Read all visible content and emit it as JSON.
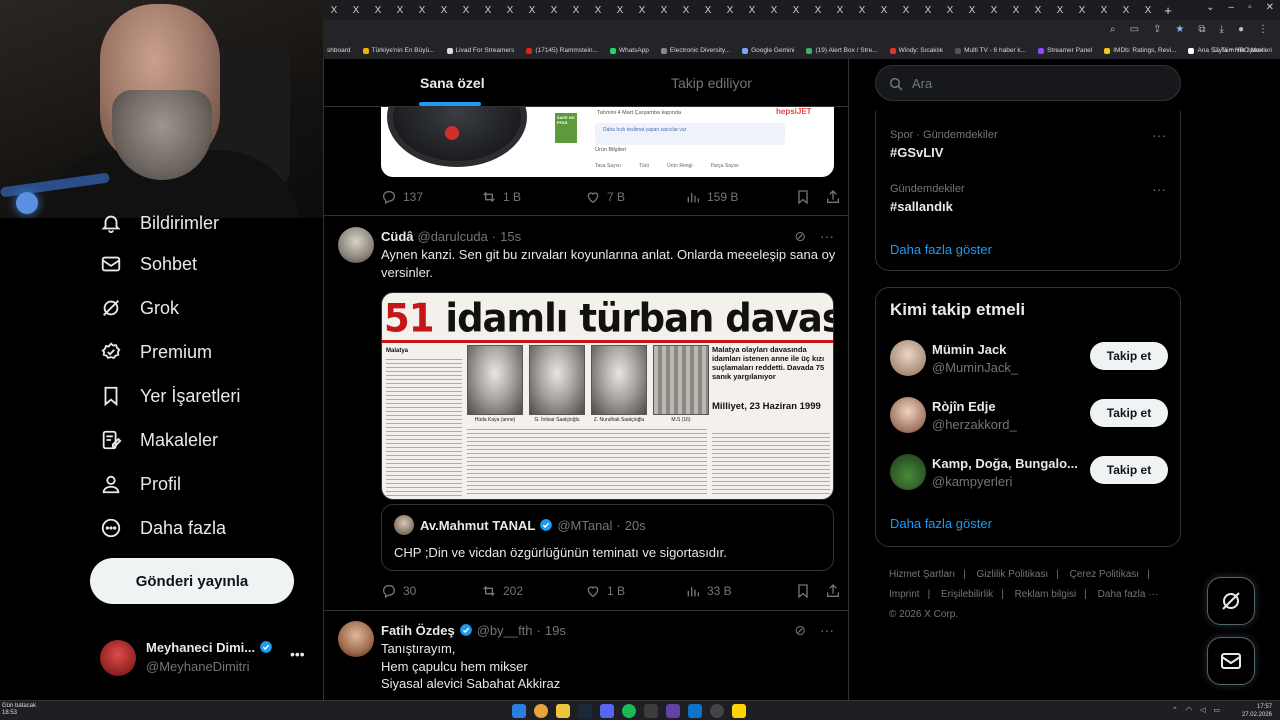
{
  "browser": {
    "tab_close_glyph": "X",
    "bookmarks": [
      "shboard",
      "Türkiye'nin En Büyü...",
      "Livad For Streamers",
      "(17145) Rammstein...",
      "WhatsApp",
      "Electronic Diversity...",
      "Google Gemini",
      "(19) Alert Box / Stre...",
      "Windy: Sıcaklık",
      "Multi TV - 6 haber k...",
      "Streamer Panel",
      "IMDb: Ratings, Revi...",
      "Ana Sayfa + HBO Max"
    ],
    "bookmarks_all": "Tüm Yer İşaretleri"
  },
  "nav": {
    "items": [
      {
        "label": "Bildirimler",
        "icon": "bell-icon"
      },
      {
        "label": "Sohbet",
        "icon": "mail-icon"
      },
      {
        "label": "Grok",
        "icon": "grok-icon"
      },
      {
        "label": "Premium",
        "icon": "premium-icon"
      },
      {
        "label": "Yer İşaretleri",
        "icon": "bookmark-icon"
      },
      {
        "label": "Makaleler",
        "icon": "article-icon"
      },
      {
        "label": "Profil",
        "icon": "person-icon"
      },
      {
        "label": "Daha fazla",
        "icon": "more-circle-icon"
      }
    ],
    "post_button": "Gönderi yayınla",
    "account": {
      "name": "Meyhaneci Dimi...",
      "handle": "@MeyhaneDimitri",
      "more": "•••"
    }
  },
  "feed": {
    "tabs": {
      "for_you": "Sana özel",
      "following": "Takip ediliyor"
    },
    "product_snippet": {
      "line1": "Tahmini 4 Mart Çarşamba kapında",
      "line2": "Daha hızlı teslimat yapan satıcılar var",
      "section": "Ürün Bilgileri",
      "cols": [
        "Tava Sayısı",
        "Türü",
        "Ürün Rengi",
        "Parça Sayısı"
      ],
      "brand": "hepsiJET",
      "badge": "SAFE NO PFAS"
    },
    "tweet0_actions": {
      "replies": "137",
      "reposts": "1 B",
      "likes": "7 B",
      "views": "159 B"
    },
    "tweet1": {
      "name": "Cüdâ",
      "handle": "@darulcuda",
      "time": "15s",
      "text": "Aynen kanzi. Sen git bu zırvaları koyunlarına anlat. Onlarda meeeleşip sana oy versinler.",
      "image": {
        "headline_num": "51",
        "headline_rest": "idamlı türban davası",
        "region": "Malatya",
        "lead": "Malatya olayları davasında idamları istenen anne ile üç kızı suçlamaları reddetti. Davada 75 sanık yargılanıyor",
        "source": "Milliyet, 23 Haziran 1999",
        "captions": [
          "Hüda Kaya (anne)",
          "G. İntisar Saatçioğlu",
          "Z. Nurulhak Saatçioğlu",
          "M.S (16)"
        ]
      },
      "quote": {
        "name": "Av.Mahmut TANAL",
        "handle": "@MTanal",
        "time": "20s",
        "text": "CHP ;Din ve vicdan özgürlüğünün teminatı ve sigortasıdır."
      },
      "actions": {
        "replies": "30",
        "reposts": "202",
        "likes": "1 B",
        "views": "33 B"
      }
    },
    "tweet2": {
      "name": "Fatih Özdeş",
      "handle": "@by__fth",
      "time": "19s",
      "lines": [
        "Tanıştırayım,",
        "Hem çapulcu hem mikser",
        "Siyasal alevici Sabahat Akkiraz"
      ]
    }
  },
  "sidebar": {
    "search_placeholder": "Ara",
    "trends": [
      {
        "category": "Spor · Gündemdekiler",
        "tag": "#GSvLIV"
      },
      {
        "category": "Gündemdekiler",
        "tag": "#sallandık"
      }
    ],
    "show_more": "Daha fazla göster",
    "who_to_follow": {
      "title": "Kimi takip etmeli",
      "users": [
        {
          "name": "Mümin Jack",
          "handle": "@MuminJack_"
        },
        {
          "name": "Ròjîn Edje",
          "handle": "@herzakkord_"
        },
        {
          "name": "Kamp, Doğa, Bungalo...",
          "handle": "@kampyerleri"
        }
      ],
      "follow_label": "Takip et",
      "show_more": "Daha fazla göster"
    },
    "footer": [
      "Hizmet Şartları",
      "Gizlilik Politikası",
      "Çerez Politikası",
      "Imprint",
      "Erişilebilirlik",
      "Reklam bilgisi",
      "Daha fazla ···",
      "© 2026 X Corp."
    ],
    "footer_separator": "|"
  },
  "taskbar": {
    "weather_line1": "Gün batacak",
    "weather_line2": "18:53",
    "time": "17:57",
    "date": "27.02.2026"
  }
}
